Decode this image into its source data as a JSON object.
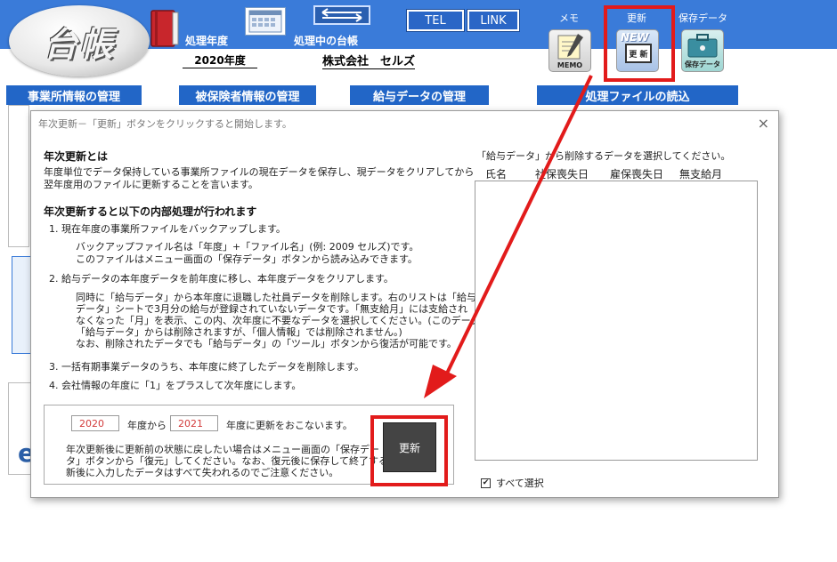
{
  "header": {
    "logo_text": "台帳",
    "fiscal_year_label": "処理年度",
    "fiscal_year_value": "2020年度",
    "current_ledger_label": "処理中の台帳",
    "company_name": "株式会社　セルズ",
    "tel_label": "TEL",
    "link_label": "LINK",
    "memo_label": "メモ",
    "memo_caption": "MEMO",
    "update_label": "更新",
    "update_icon_text": "更 新",
    "update_icon_badge": "NEW",
    "saved_data_label": "保存データ",
    "saved_data_caption": "保存データ"
  },
  "menu_tabs": [
    "事業所情報の管理",
    "被保険者情報の管理",
    "給与データの管理",
    "処理ファイルの読込"
  ],
  "dialog": {
    "title": "年次更新－「更新」ボタンをクリックすると開始します。",
    "close_glyph": "×",
    "section1_title": "年次更新とは",
    "section1_lines": [
      "年度単位でデータ保持している事業所ファイルの現在データを保存し、現データをクリアしてから",
      "翌年度用のファイルに更新することを言います。"
    ],
    "section2_title": "年次更新すると以下の内部処理が行われます",
    "step1": "1. 現在年度の事業所ファイルをバックアップします。",
    "step1_detail": [
      "バックアップファイル名は「年度」+「ファイル名」(例: 2009 セルズ)です。",
      "このファイルはメニュー画面の「保存データ」ボタンから読み込みできます。"
    ],
    "step2": "2. 給与データの本年度データを前年度に移し、本年度データをクリアします。",
    "step2_detail": [
      "同時に「給与データ」から本年度に退職した社員データを削除します。右のリストは「給与",
      "データ」シートで3月分の給与が登録されていないデータです。「無支給月」には支給され",
      "なくなった「月」を表示、この内、次年度に不要なデータを選択してください。(このデータは",
      "「給与データ」からは削除されますが、「個人情報」では削除されません。)",
      "なお、削除されたデータでも「給与データ」の「ツール」ボタンから復活が可能です。"
    ],
    "step3": "3. 一括有期事業データのうち、本年度に終了したデータを削除します。",
    "step4": "4. 会社情報の年度に「1」をプラスして次年度にします。",
    "from_year": "2020",
    "from_label": "年度から",
    "to_year": "2021",
    "to_label": "年度に更新をおこないます。",
    "note_lines": [
      "年次更新後に更新前の状態に戻したい場合はメニュー画面の「保存デー",
      "タ」ボタンから「復元」してください。なお、復元後に保存して終了すると、更",
      "新後に入力したデータはすべて失われるのでご注意ください。"
    ],
    "update_button": "更新",
    "list_caption": "「給与データ」から削除するデータを選択してください。",
    "list_columns": [
      "氏名",
      "社保喪失日",
      "雇保喪失日",
      "無支給月"
    ],
    "select_all_label": "すべて選択",
    "select_all_checked": true,
    "select_all_glyph": "✔"
  },
  "colors": {
    "banner": "#3a7bd9",
    "highlight": "#e21b1b",
    "year_text": "#d23b3b",
    "button_dark": "#444444"
  }
}
